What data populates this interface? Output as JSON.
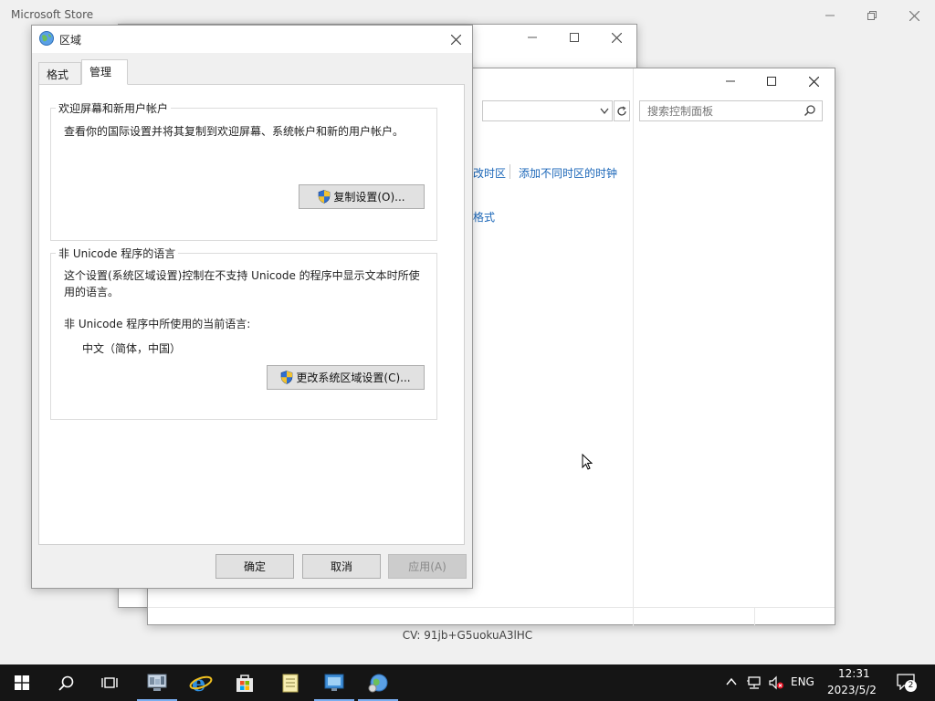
{
  "store": {
    "title": "Microsoft Store",
    "cv_text": "CV: 91jb+G5uokuA3lHC"
  },
  "control_panel": {
    "search_placeholder": "搜索控制面板",
    "link_timezone_fragment": "改时区",
    "link_add_clocks": "添加不同时区的时钟",
    "link_format_fragment": "格式"
  },
  "dialog": {
    "title": "区域",
    "tabs": [
      {
        "label": "格式"
      },
      {
        "label": "管理"
      }
    ],
    "active_tab": "管理",
    "welcome_group": {
      "legend": "欢迎屏幕和新用户帐户",
      "description": "查看你的国际设置并将其复制到欢迎屏幕、系统帐户和新的用户帐户。",
      "button": "复制设置(O)..."
    },
    "unicode_group": {
      "legend": "非 Unicode 程序的语言",
      "description_line1": "这个设置(系统区域设置)控制在不支持 Unicode 的程序中显示文本时所使",
      "description_line2": "用的语言。",
      "current_label": "非 Unicode 程序中所使用的当前语言:",
      "current_value": "中文（简体，中国）",
      "button": "更改系统区域设置(C)..."
    },
    "ok": "确定",
    "cancel": "取消",
    "apply": "应用(A)"
  },
  "taskbar": {
    "items": [
      {
        "icon": "start-icon"
      },
      {
        "icon": "search-icon"
      },
      {
        "icon": "task-view-icon"
      },
      {
        "icon": "control-panel-app-icon"
      },
      {
        "icon": "internet-explorer-icon"
      },
      {
        "icon": "store-icon"
      },
      {
        "icon": "notepad-icon"
      },
      {
        "icon": "remote-app-icon"
      },
      {
        "icon": "region-app-icon"
      }
    ],
    "language": "ENG",
    "time": "12:31",
    "date": "2023/5/2",
    "notification_count": "2"
  },
  "colors": {
    "link": "#1a66b8",
    "taskbar": "#151515",
    "accent": "#7aaef0"
  }
}
